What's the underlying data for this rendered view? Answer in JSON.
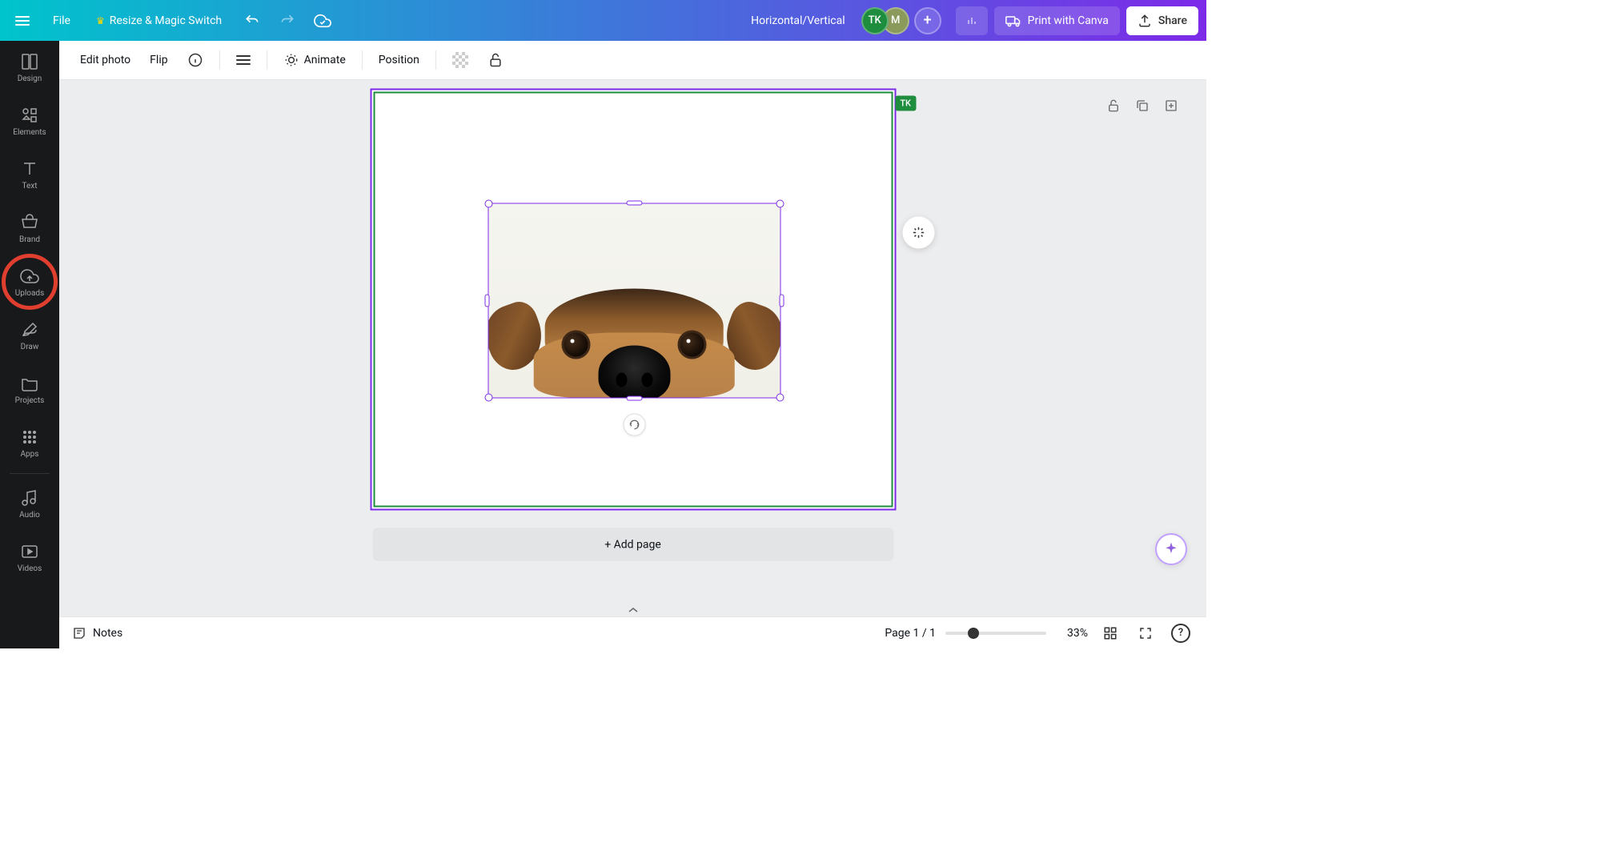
{
  "header": {
    "file_label": "File",
    "resize_label": "Resize & Magic Switch",
    "project_name": "Horizontal/Vertical",
    "avatar1": "TK",
    "avatar2": "M",
    "print_label": "Print with Canva",
    "share_label": "Share"
  },
  "sidebar": {
    "items": [
      {
        "label": "Design"
      },
      {
        "label": "Elements"
      },
      {
        "label": "Text"
      },
      {
        "label": "Brand"
      },
      {
        "label": "Uploads"
      },
      {
        "label": "Draw"
      },
      {
        "label": "Projects"
      },
      {
        "label": "Apps"
      },
      {
        "label": "Audio"
      },
      {
        "label": "Videos"
      }
    ]
  },
  "toolbar": {
    "edit_photo": "Edit photo",
    "flip": "Flip",
    "animate": "Animate",
    "position": "Position"
  },
  "canvas": {
    "page_badge": "TK",
    "add_page": "+ Add page"
  },
  "bottom": {
    "notes": "Notes",
    "page_indicator": "Page 1 / 1",
    "zoom_pct": "33%"
  }
}
